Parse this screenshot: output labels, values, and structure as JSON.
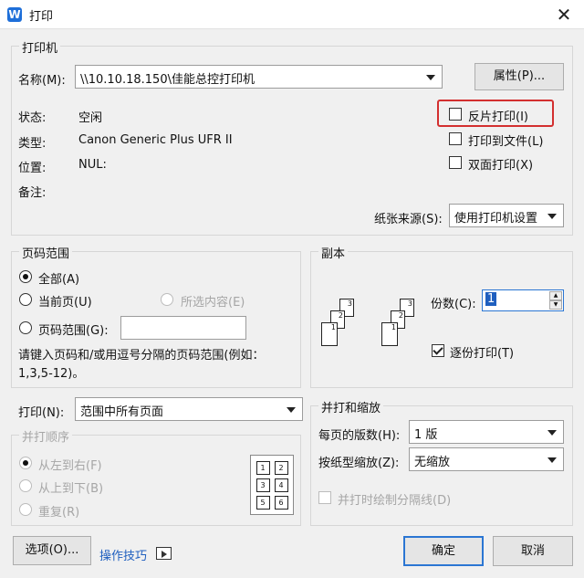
{
  "window": {
    "title": "打印",
    "close_icon": "close-icon",
    "app_icon": "W"
  },
  "printer": {
    "group_title": "打印机",
    "name_label": "名称(M):",
    "name_value": "\\\\10.10.18.150\\佳能总控打印机",
    "properties_button": "属性(P)...",
    "status_label": "状态:",
    "status_value": "空闲",
    "type_label": "类型:",
    "type_value": "Canon Generic Plus UFR II",
    "location_label": "位置:",
    "location_value": "NUL:",
    "comment_label": "备注:",
    "reverse_print": "反片打印(I)",
    "print_to_file": "打印到文件(L)",
    "duplex": "双面打印(X)",
    "paper_source_label": "纸张来源(S):",
    "paper_source_value": "使用打印机设置",
    "highlight_color": "#d32f2f"
  },
  "page_range": {
    "group_title": "页码范围",
    "all": "全部(A)",
    "current": "当前页(U)",
    "selection": "所选内容(E)",
    "pages": "页码范围(G):",
    "hint": "请键入页码和/或用逗号分隔的页码范围(例如：1,3,5-12)。",
    "selected": "all"
  },
  "copies": {
    "group_title": "副本",
    "count_label": "份数(C):",
    "count_value": "1",
    "collate": "逐份打印(T)",
    "collate_checked": true
  },
  "print_what": {
    "label": "打印(N):",
    "value": "范围中所有页面"
  },
  "order": {
    "group_title": "并打顺序",
    "lr": "从左到右(F)",
    "tb": "从上到下(B)",
    "repeat": "重复(R)",
    "grid": [
      "1",
      "2",
      "3",
      "4",
      "5",
      "6"
    ]
  },
  "zoom": {
    "group_title": "并打和缩放",
    "pps_label": "每页的版数(H):",
    "pps_value": "1 版",
    "scale_label": "按纸型缩放(Z):",
    "scale_value": "无缩放",
    "draw_lines": "并打时绘制分隔线(D)"
  },
  "footer": {
    "options": "选项(O)...",
    "tips": "操作技巧",
    "ok": "确定",
    "cancel": "取消",
    "accent": "#2b76d3"
  }
}
